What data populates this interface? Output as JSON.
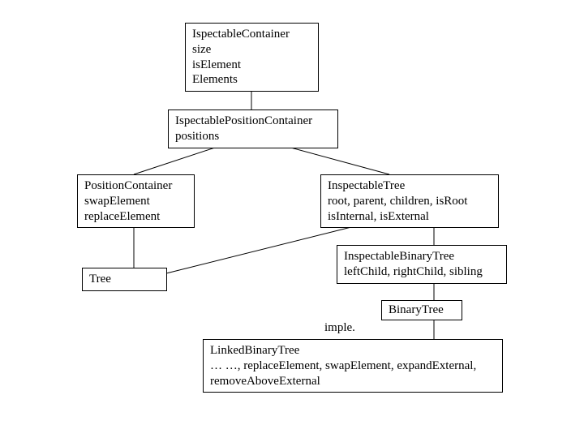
{
  "nodes": {
    "ic": {
      "title": "IspectableContainer",
      "l1": "size",
      "l2": "isElement",
      "l3": "Elements"
    },
    "ipc": {
      "title": "IspectablePositionContainer",
      "l1": "positions"
    },
    "pc": {
      "title": "PositionContainer",
      "l1": "swapElement",
      "l2": "replaceElement"
    },
    "it": {
      "title": "InspectableTree",
      "l1": "root, parent, children, isRoot",
      "l2": "isInternal, isExternal"
    },
    "tree": {
      "title": "Tree"
    },
    "ibt": {
      "title": "InspectableBinaryTree",
      "l1": "leftChild, rightChild, sibling"
    },
    "bt": {
      "title": "BinaryTree"
    },
    "lbt": {
      "title": "LinkedBinaryTree",
      "l1": "… …, replaceElement, swapElement, expandExternal,",
      "l2": "removeAboveExternal"
    }
  },
  "labels": {
    "imple": "imple."
  }
}
